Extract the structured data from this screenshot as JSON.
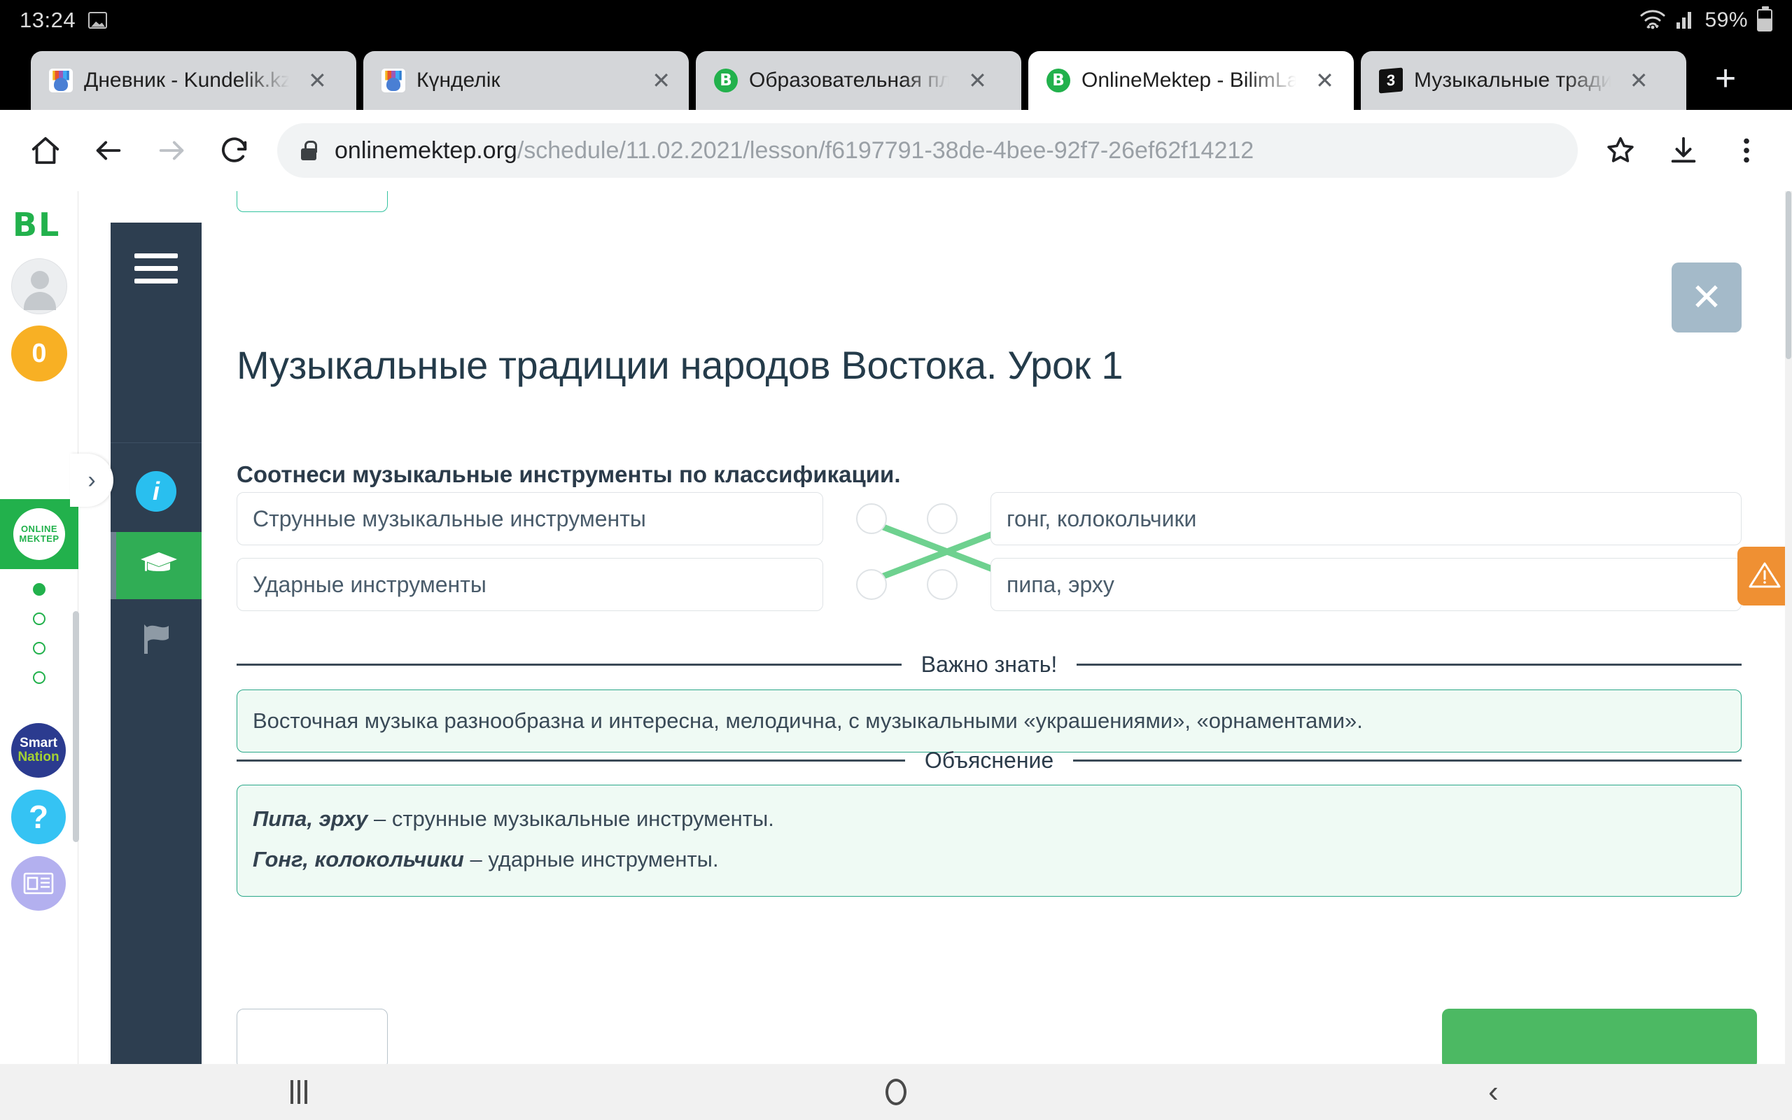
{
  "status_bar": {
    "time": "13:24",
    "battery_percent": "59%",
    "icons": [
      "photo-icon",
      "wifi-icon",
      "signal-icon",
      "battery-icon"
    ]
  },
  "browser": {
    "tabs": [
      {
        "title": "Дневник - Kundelik.kz",
        "favicon": "kundelik-hand-icon",
        "active": false
      },
      {
        "title": "Күнделік",
        "favicon": "kundelik-hand-icon",
        "active": false
      },
      {
        "title": "Образовательная пл",
        "favicon": "bilimland-b-icon",
        "active": false
      },
      {
        "title": "OnlineMektep - BilimLa",
        "favicon": "bilimland-b-icon",
        "active": true
      },
      {
        "title": "Музыкальные тради",
        "favicon": "black-3-icon",
        "active": false
      }
    ],
    "close_label": "✕",
    "new_tab_label": "+",
    "toolbar": {
      "home_icon": "home-icon",
      "back_icon": "back-arrow-icon",
      "forward_icon": "forward-arrow-icon",
      "reload_icon": "reload-icon",
      "bookmark_icon": "star-icon",
      "download_icon": "download-icon",
      "menu_icon": "kebab-menu-icon"
    },
    "url": {
      "lock_icon": "lock-icon",
      "host": "onlinemektep.org",
      "path": "/schedule/11.02.2021/lesson/f6197791-38de-4bee-92f7-26ef62f14212"
    }
  },
  "rail": {
    "logo": "BL",
    "avatar": "user-avatar",
    "badge_count": "0",
    "brand_line1": "ONLINE",
    "brand_line2": "MEKTEP",
    "steps": [
      true,
      false,
      false,
      false
    ],
    "smart_nation_line1": "Smart",
    "smart_nation_line2": "Nation",
    "help_label": "?",
    "news_icon": "news-card-icon"
  },
  "dark_nav": {
    "burger": "hamburger-menu-icon",
    "info_label": "i",
    "items": [
      "info-icon",
      "graduation-cap-icon",
      "flag-icon"
    ],
    "pull_tab": "›"
  },
  "lesson": {
    "title": "Музыкальные традиции народов Востока. Урок 1",
    "close_label": "✕",
    "question": "Соотнеси музыкальные инструменты по классификации.",
    "left_items": [
      "Струнные музыкальные инструменты",
      "Ударные инструменты"
    ],
    "right_items": [
      "гонг, колокольчики",
      "пипа, эрху"
    ],
    "connections": [
      {
        "from": 0,
        "to": 1
      },
      {
        "from": 1,
        "to": 0
      }
    ],
    "connection_color": "#6ed18f",
    "important_label": "Важно знать!",
    "important_text": "Восточная музыка разнообразна и интересна, мелодична, с музыкальными «украшениями», «орнаментами».",
    "explanation_label": "Объяснение",
    "explanation": [
      {
        "term": "Пипа, эрху",
        "rest": " – струнные музыкальные инструменты."
      },
      {
        "term": "Гонг, колокольчики",
        "rest": " – ударные инструменты."
      }
    ],
    "warning_icon": "warning-triangle-icon",
    "accent_green": "#2aa889",
    "accent_orange": "#ef9033"
  },
  "android_nav": {
    "recents": "recents-icon",
    "home": "home-circle-icon",
    "back": "back-chevron-icon"
  }
}
